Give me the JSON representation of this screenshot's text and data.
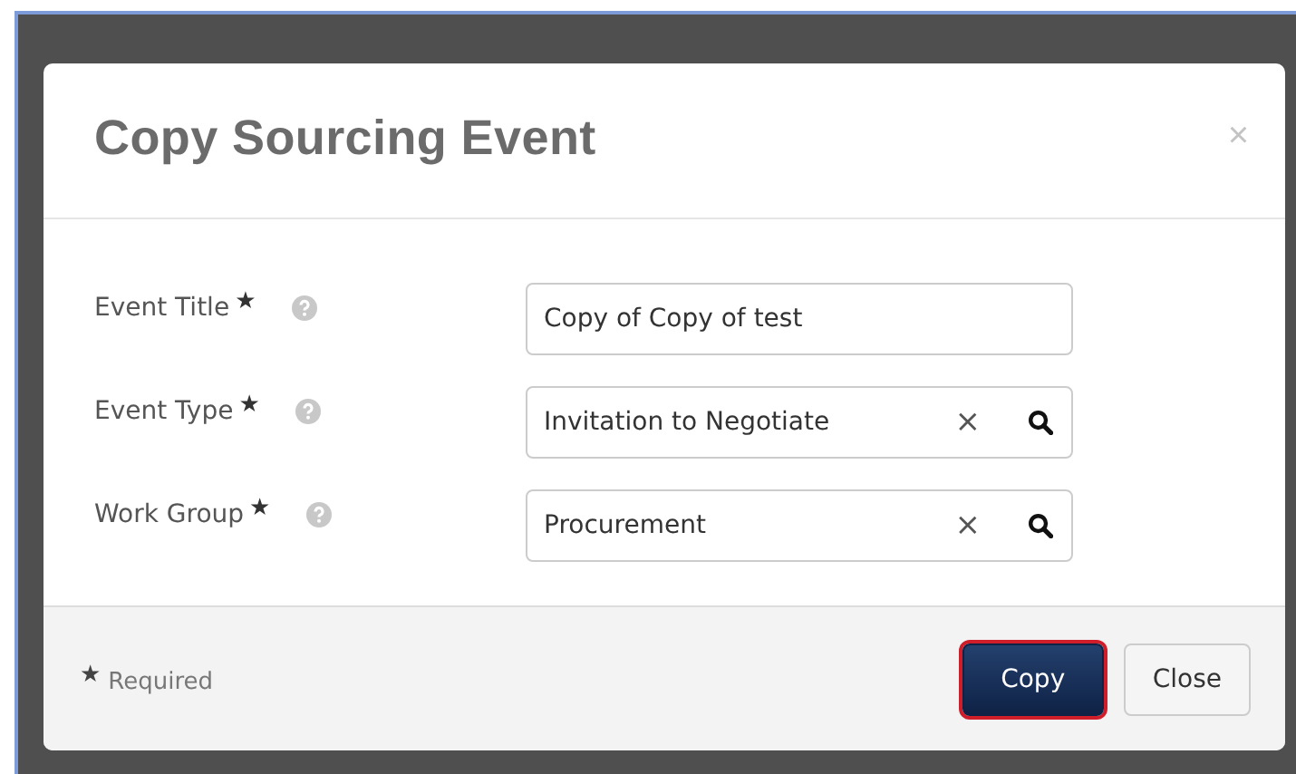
{
  "dialog": {
    "title": "Copy Sourcing Event",
    "close": "×"
  },
  "fields": [
    {
      "label": "Event Title",
      "required": "★",
      "kind": "text",
      "value": "Copy of Copy of test"
    },
    {
      "label": "Event Type",
      "required": "★",
      "kind": "lookup",
      "value": "Invitation to Negotiate",
      "clear": "×"
    },
    {
      "label": "Work Group",
      "required": "★",
      "kind": "lookup",
      "value": "Procurement",
      "clear": "×"
    }
  ],
  "footer": {
    "required_mark": "★",
    "required_note": "Required"
  },
  "buttons": [
    {
      "label": "Copy",
      "kind": "primary",
      "focused": true
    },
    {
      "label": "Close",
      "kind": "default",
      "focused": false
    }
  ]
}
